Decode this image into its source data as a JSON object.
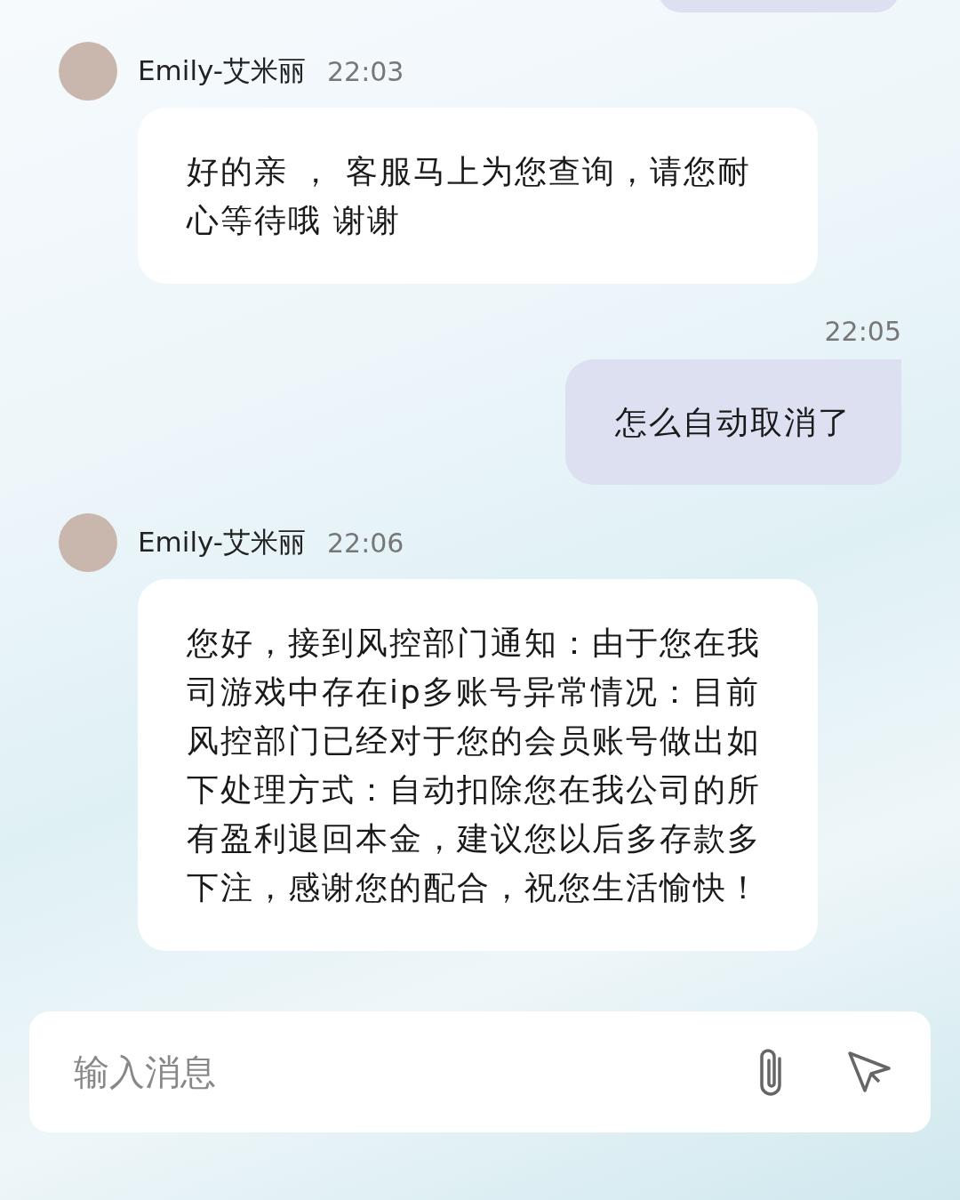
{
  "messages": [
    {
      "kind": "incoming",
      "sender": "Emily-艾米丽",
      "time": "22:03",
      "text": "好的亲 ， 客服马上为您查询，请您耐心等待哦 谢谢"
    },
    {
      "kind": "outgoing",
      "time": "22:05",
      "text": "怎么自动取消了"
    },
    {
      "kind": "incoming",
      "sender": "Emily-艾米丽",
      "time": "22:06",
      "text": "您好，接到风控部门通知：由于您在我司游戏中存在ip多账号异常情况：目前风控部门已经对于您的会员账号做出如下处理方式：自动扣除您在我公司的所有盈利退回本金，建议您以后多存款多下注，感谢您的配合，祝您生活愉快！"
    }
  ],
  "composer": {
    "placeholder": "输入消息"
  }
}
